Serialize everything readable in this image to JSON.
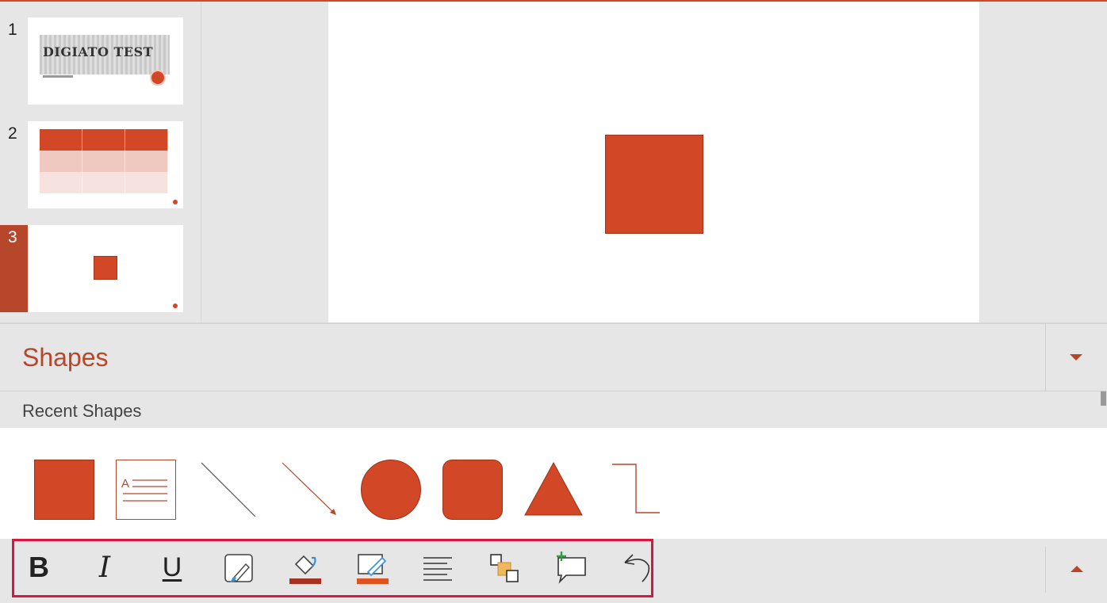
{
  "colors": {
    "accent": "#b7472a",
    "shape_fill": "#d24726",
    "highlight_frame": "#d9163f"
  },
  "thumbnails": [
    {
      "number": "1",
      "title": "DIGIATO TEST"
    },
    {
      "number": "2"
    },
    {
      "number": "3",
      "selected": true
    }
  ],
  "shapes_panel": {
    "title": "Shapes",
    "recent_label": "Recent Shapes",
    "items": [
      "rectangle-shape",
      "text-box-shape",
      "line-shape",
      "arrow-shape",
      "oval-shape",
      "rounded-rectangle-shape",
      "triangle-shape",
      "elbow-connector-shape"
    ]
  },
  "toolbar": {
    "bold": "B",
    "italic": "I",
    "underline": "U",
    "buttons": [
      "bold-button",
      "italic-button",
      "underline-button",
      "shape-style-button",
      "fill-color-button",
      "outline-color-button",
      "align-button",
      "arrange-button",
      "new-comment-button",
      "undo-button"
    ]
  }
}
